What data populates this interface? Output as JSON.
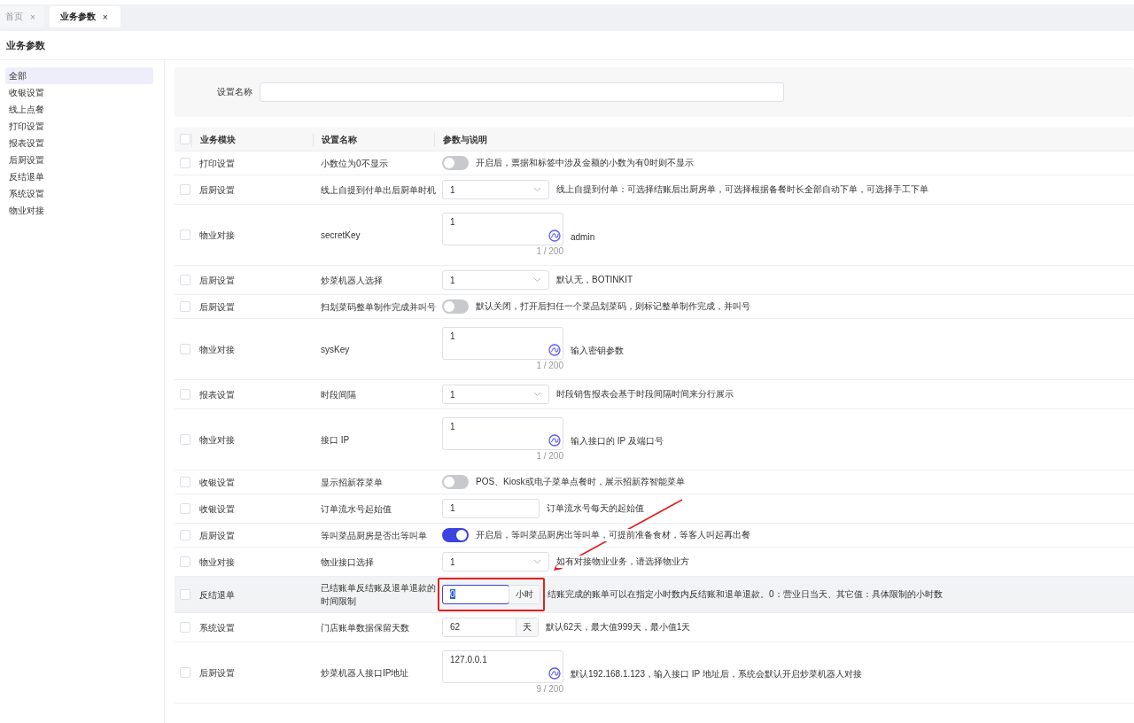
{
  "tabs": [
    {
      "label": "首页",
      "close": "×",
      "selected": false
    },
    {
      "label": "业务参数",
      "close": "×",
      "selected": true
    }
  ],
  "page_title": "业务参数",
  "sidebar": {
    "items": [
      {
        "label": "全部",
        "selected": true
      },
      {
        "label": "收银设置",
        "selected": false
      },
      {
        "label": "线上点餐",
        "selected": false
      },
      {
        "label": "打印设置",
        "selected": false
      },
      {
        "label": "报表设置",
        "selected": false
      },
      {
        "label": "后厨设置",
        "selected": false
      },
      {
        "label": "反结退单",
        "selected": false
      },
      {
        "label": "系统设置",
        "selected": false
      },
      {
        "label": "物业对接",
        "selected": false
      }
    ]
  },
  "filter": {
    "label": "设置名称"
  },
  "table": {
    "all_checked": false,
    "columns": [
      "业务模块",
      "设置名称",
      "参数与说明"
    ],
    "rows": [
      {
        "checked": false,
        "hover": false,
        "module": "打印设置",
        "name": "小数位为0不显示",
        "kind": "switch",
        "on": false,
        "description": "开启后，票据和标签中涉及金额的小数为有0时则不显示"
      },
      {
        "checked": false,
        "hover": false,
        "module": "后厨设置",
        "name": "线上自提到付单出后厨单时机",
        "kind": "select",
        "value": "1",
        "description": "线上自提到付单：可选择结账后出厨房单，可选择根据备餐时长全部自动下单，可选择手工下单"
      },
      {
        "checked": false,
        "hover": false,
        "module": "物业对接",
        "name": "secretKey",
        "kind": "textarea",
        "value": "1",
        "counter": "1 / 200",
        "description": "admin"
      },
      {
        "checked": false,
        "hover": false,
        "module": "后厨设置",
        "name": "炒菜机器人选择",
        "kind": "select",
        "value": "1",
        "description": "默认无，BOTINKIT"
      },
      {
        "checked": false,
        "hover": false,
        "module": "后厨设置",
        "name": "扫划菜码整单制作完成并叫号",
        "kind": "switch",
        "on": false,
        "description": "默认关闭，打开后扫任一个菜品划菜码，则标记整单制作完成，并叫号"
      },
      {
        "checked": false,
        "hover": false,
        "module": "物业对接",
        "name": "sysKey",
        "kind": "textarea",
        "value": "1",
        "counter": "1 / 200",
        "description": "输入密钥参数"
      },
      {
        "checked": false,
        "hover": false,
        "module": "报表设置",
        "name": "时段间隔",
        "kind": "select",
        "value": "1",
        "description": "时段销售报表会基于时段间隔时间来分行展示"
      },
      {
        "checked": false,
        "hover": false,
        "module": "物业对接",
        "name": "接口 IP",
        "kind": "textarea",
        "value": "1",
        "counter": "1 / 200",
        "description": "输入接口的 IP 及端口号"
      },
      {
        "checked": false,
        "hover": false,
        "module": "收银设置",
        "name": "显示招新荐菜单",
        "kind": "switch",
        "on": false,
        "description": "POS、Kiosk或电子菜单点餐时，展示招新荐智能菜单"
      },
      {
        "checked": false,
        "hover": false,
        "module": "收银设置",
        "name": "订单流水号起始值",
        "kind": "input",
        "value": "1",
        "description": "订单流水号每天的起始值"
      },
      {
        "checked": false,
        "hover": false,
        "module": "后厨设置",
        "name": "等叫菜品厨房是否出等叫单",
        "kind": "switch",
        "on": true,
        "description": "开启后，等叫菜品厨房出等叫单，可提前准备食材，等客人叫起再出餐"
      },
      {
        "checked": false,
        "hover": false,
        "module": "物业对接",
        "name": "物业接口选择",
        "kind": "select",
        "value": "1",
        "description": "如有对接物业业务，请选择物业方"
      },
      {
        "checked": false,
        "hover": true,
        "module": "反结退单",
        "name": "已结账单反结账及退单退款的时间限制",
        "kind": "addon",
        "value": "0",
        "unit": "小时",
        "focused": true,
        "annotated": true,
        "description": "结账完成的账单可以在指定小时数内反结账和退单退款。0：营业日当天、其它值：具体限制的小时数"
      },
      {
        "checked": false,
        "hover": false,
        "module": "系统设置",
        "name": "门店账单数据保留天数",
        "kind": "addon",
        "value": "62",
        "unit": "天",
        "focused": false,
        "annotated": false,
        "description": "默认62天，最大值999天，最小值1天"
      },
      {
        "checked": false,
        "hover": false,
        "module": "后厨设置",
        "name": "炒菜机器人接口IP地址",
        "kind": "textarea",
        "value": "127.0.0.1",
        "counter": "9 / 200",
        "description": "默认192.168.1.123，输入接口 IP 地址后，系统会默认开启炒菜机器人对接"
      }
    ]
  }
}
